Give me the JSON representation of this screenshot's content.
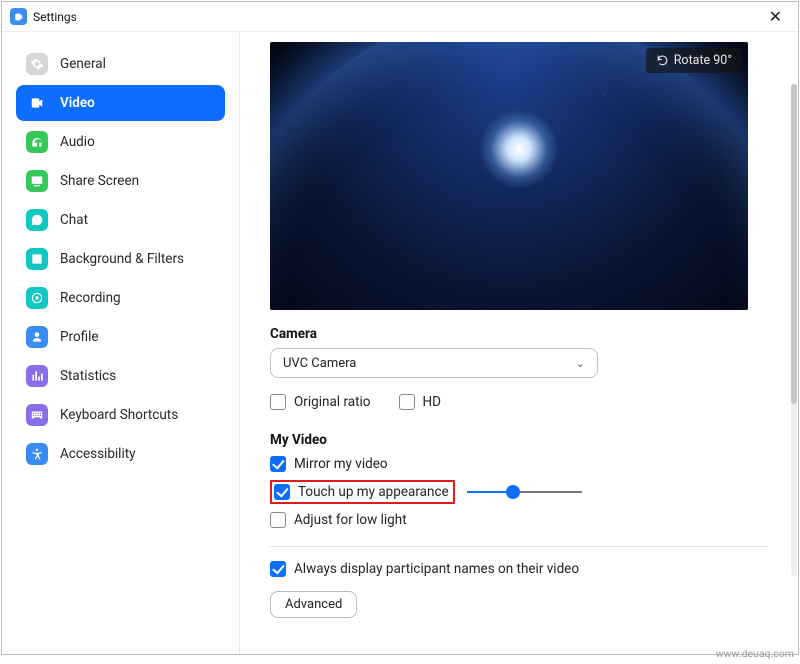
{
  "window": {
    "title": "Settings"
  },
  "sidebar": {
    "items": [
      {
        "label": "General"
      },
      {
        "label": "Video"
      },
      {
        "label": "Audio"
      },
      {
        "label": "Share Screen"
      },
      {
        "label": "Chat"
      },
      {
        "label": "Background & Filters"
      },
      {
        "label": "Recording"
      },
      {
        "label": "Profile"
      },
      {
        "label": "Statistics"
      },
      {
        "label": "Keyboard Shortcuts"
      },
      {
        "label": "Accessibility"
      }
    ]
  },
  "preview": {
    "rotate_label": "Rotate 90°"
  },
  "camera": {
    "title": "Camera",
    "selected": "UVC Camera",
    "original_ratio": "Original ratio",
    "hd": "HD"
  },
  "my_video": {
    "title": "My Video",
    "mirror": "Mirror my video",
    "touchup": "Touch up my appearance",
    "lowlight": "Adjust for low light"
  },
  "participant_names": "Always display participant names on their video",
  "advanced_label": "Advanced",
  "watermark": "www.deuaq.com"
}
